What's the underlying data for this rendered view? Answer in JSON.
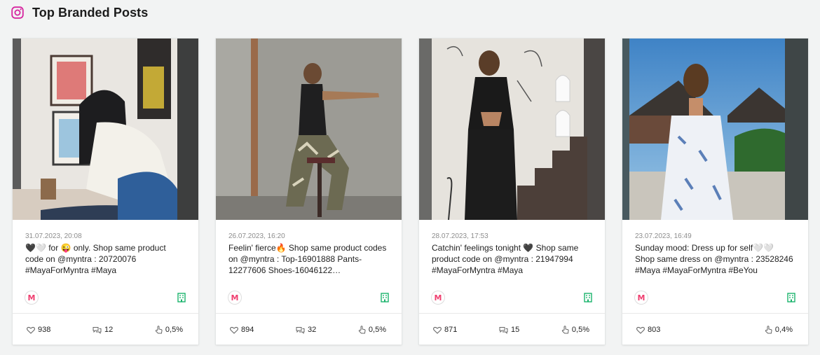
{
  "header": {
    "title": "Top Branded Posts",
    "icon": "instagram-icon",
    "icon_color": "#d6249f"
  },
  "brand": {
    "avatar_letter": "M",
    "avatar_color": "#ef3f6f",
    "brand_icon": "building-icon",
    "brand_icon_color": "#19b36b"
  },
  "posts": [
    {
      "date": "31.07.2023, 20:08",
      "caption": "🖤🤍 for 😜 only. Shop same product code on @myntra : 20720076 #MayaForMyntra #Maya",
      "likes": "938",
      "comments": "12",
      "engagement": "0,5%"
    },
    {
      "date": "26.07.2023, 16:20",
      "caption": "Feelin' fierce🔥 Shop same product codes on @myntra : Top-16901888 Pants-12277606 Shoes-16046122…",
      "likes": "894",
      "comments": "32",
      "engagement": "0,5%"
    },
    {
      "date": "28.07.2023, 17:53",
      "caption": "Catchin' feelings tonight 🖤 Shop same product code on @myntra : 21947994 #MayaForMyntra #Maya",
      "likes": "871",
      "comments": "15",
      "engagement": "0,5%"
    },
    {
      "date": "23.07.2023, 16:49",
      "caption": "Sunday mood: Dress up for self🤍🤍 Shop same dress on @myntra : 23528246 #Maya #MayaForMyntra #BeYou",
      "likes": "803",
      "comments": "",
      "engagement": "0,4%"
    }
  ]
}
